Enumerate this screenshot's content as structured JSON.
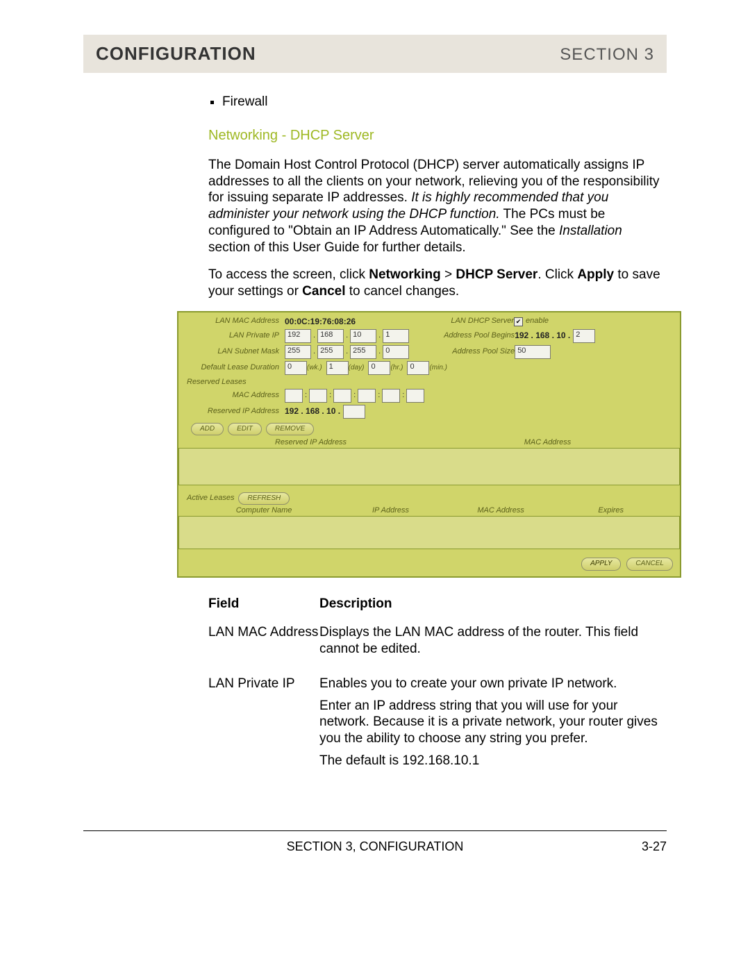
{
  "header": {
    "title": "CONFIGURATION",
    "section": "SECTION 3"
  },
  "bullets": [
    "Firewall"
  ],
  "subheading": "Networking - DHCP Server",
  "intro": {
    "p1a": "The Domain Host Control Protocol (DHCP) server automatically assigns IP addresses to all the clients on your network, relieving you of the responsibility for issuing separate IP addresses. ",
    "p1b_italic": "It is highly recommended that you administer your network using the DHCP function.",
    "p1c": " The PCs must be configured to \"Obtain an IP Address Automatically.\" See the ",
    "p1d_italic": "Installation",
    "p1e": " section of this User Guide for further details.",
    "p2a": "To access the screen, click ",
    "p2b_bold": "Networking",
    "p2c": " > ",
    "p2d_bold": "DHCP Server",
    "p2e": ". Click ",
    "p2f_bold": "Apply",
    "p2g": " to save your settings or ",
    "p2h_bold": "Cancel",
    "p2i": " to cancel changes."
  },
  "shot": {
    "labels": {
      "lan_mac": "LAN MAC Address",
      "lan_priv": "LAN Private IP",
      "lan_sub": "LAN Subnet Mask",
      "lease_dur": "Default Lease Duration",
      "dhcp_srv": "LAN DHCP Server",
      "pool_begin": "Address Pool Begins",
      "pool_size": "Address Pool Size",
      "reserved": "Reserved Leases",
      "mac_addr": "MAC Address",
      "res_ip": "Reserved IP Address",
      "active": "Active Leases",
      "comp": "Computer Name",
      "ipaddr": "IP Address",
      "expires": "Expires",
      "wk": "(wk.)",
      "day": "(day)",
      "hr": "(hr.)",
      "min": "(min.)",
      "enable": "enable"
    },
    "values": {
      "mac": "00:0C:19:76:08:26",
      "ip": [
        "192",
        "168",
        "10",
        "1"
      ],
      "mask": [
        "255",
        "255",
        "255",
        "0"
      ],
      "dur": [
        "0",
        "1",
        "0",
        "0"
      ],
      "pool_prefix": "192 . 168 . 10 .",
      "pool_last": "2",
      "pool_size": "50",
      "res_prefix": "192 . 168 . 10 ."
    },
    "buttons": {
      "add": "ADD",
      "edit": "EDIT",
      "remove": "REMOVE",
      "refresh": "REFRESH",
      "apply": "APPLY",
      "cancel": "CANCEL"
    },
    "tablehead": {
      "resip": "Reserved IP Address",
      "mac": "MAC Address"
    }
  },
  "desc": {
    "h_field": "Field",
    "h_desc": "Description",
    "rows": [
      {
        "field": "LAN MAC Address",
        "d1": "Displays the LAN MAC address of the router. This field cannot be edited."
      },
      {
        "field": "LAN Private IP",
        "d1": "Enables you to create your own private IP network.",
        "d2": "Enter an IP address string that you will use for your network. Because it is a private network, your router gives you the ability to choose any string you prefer.",
        "d3": "The default is 192.168.10.1"
      }
    ]
  },
  "footer": {
    "center": "SECTION 3, CONFIGURATION",
    "right": "3-27"
  }
}
